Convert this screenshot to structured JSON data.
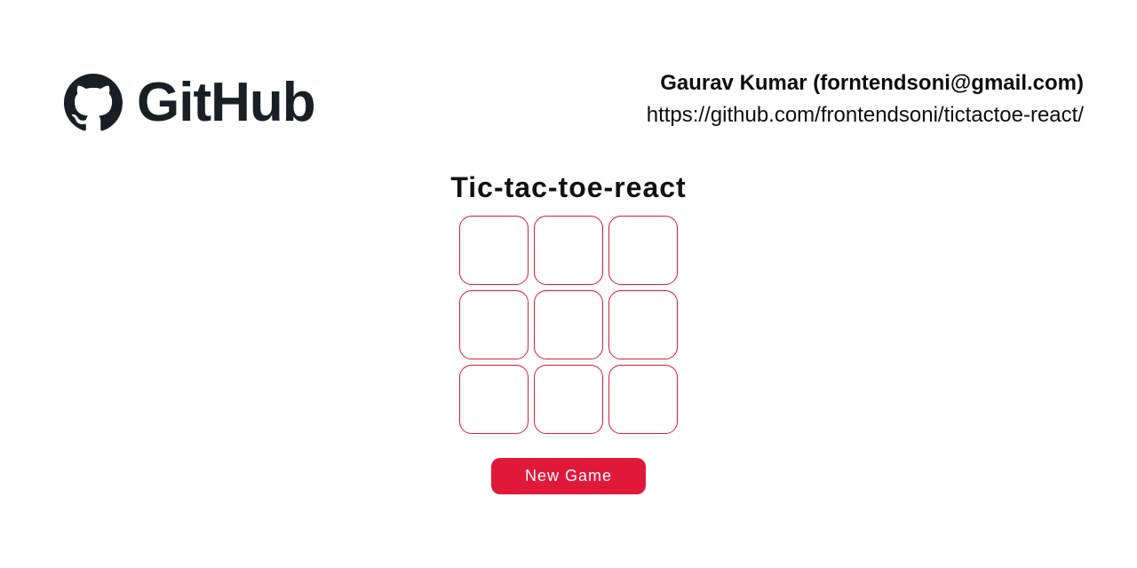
{
  "header": {
    "github_wordmark": "GitHub",
    "author_line": "Gaurav Kumar (forntendsoni@gmail.com)",
    "repo_url": "https://github.com/frontendsoni/tictactoe-react/"
  },
  "game": {
    "title": "Tic-tac-toe-react",
    "cells": [
      "",
      "",
      "",
      "",
      "",
      "",
      "",
      "",
      ""
    ],
    "new_game_label": "New Game"
  },
  "colors": {
    "accent": "#e0193b",
    "ink": "#1b1f23"
  }
}
